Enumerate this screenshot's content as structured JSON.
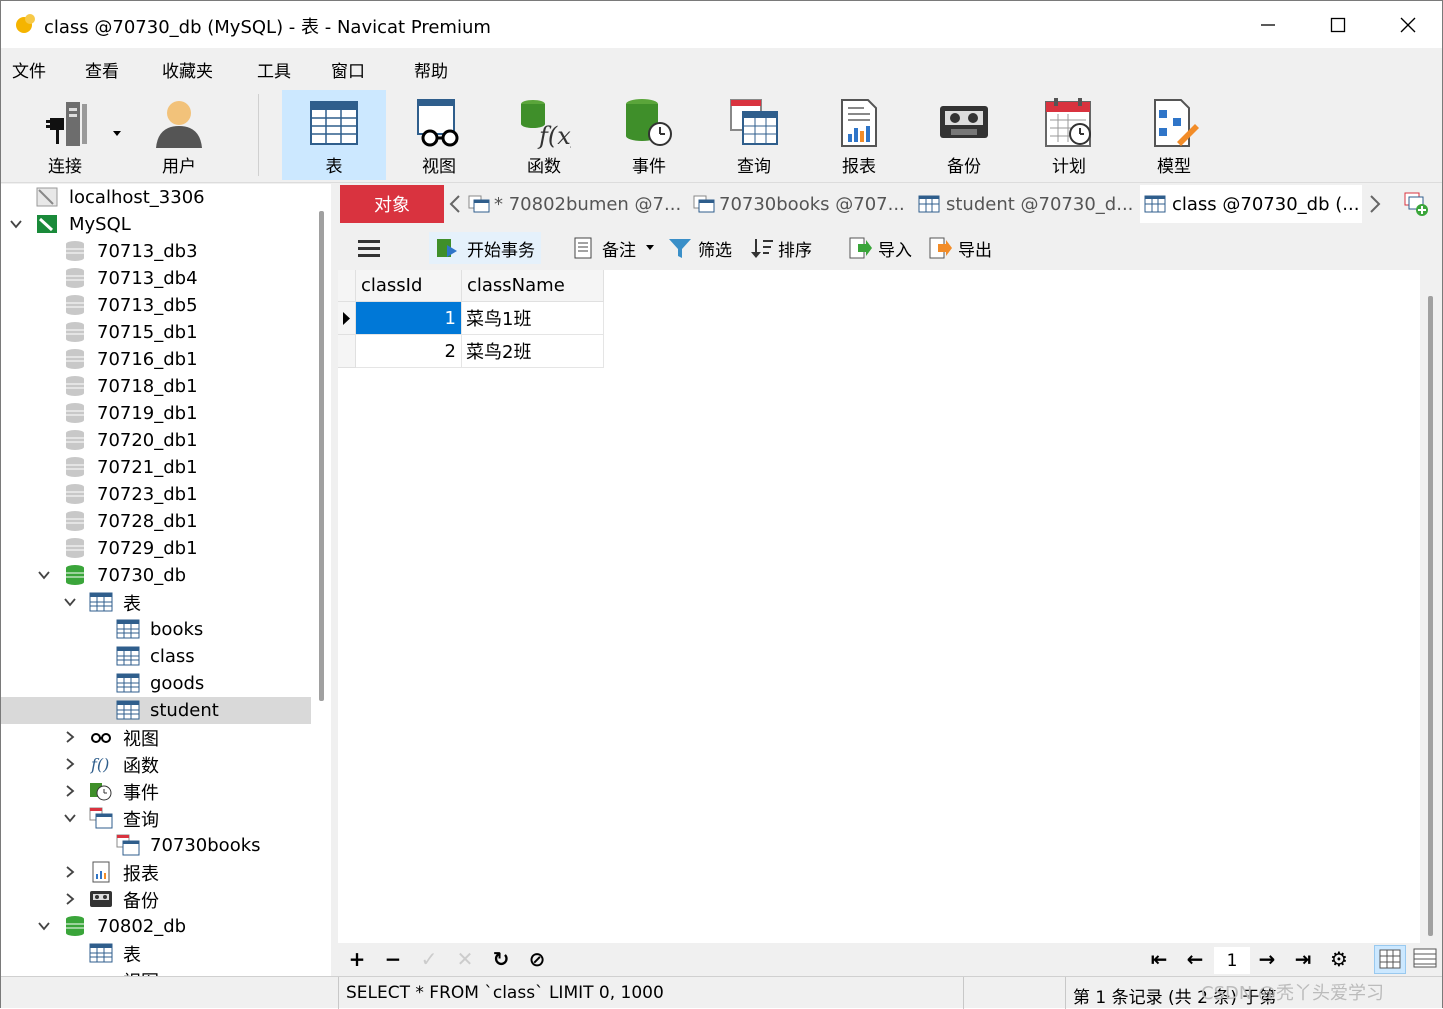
{
  "window": {
    "title": "class @70730_db (MySQL) - 表 - Navicat Premium"
  },
  "menu": [
    "文件",
    "查看",
    "收藏夹",
    "工具",
    "窗口",
    "帮助"
  ],
  "toolbar": {
    "connect": "连接",
    "user": "用户",
    "table": "表",
    "view": "视图",
    "function": "函数",
    "event": "事件",
    "query": "查询",
    "report": "报表",
    "backup": "备份",
    "schedule": "计划",
    "model": "模型"
  },
  "tree": {
    "connection": "localhost_3306",
    "mysql": "MySQL",
    "dbs": [
      "70713_db3",
      "70713_db4",
      "70713_db5",
      "70715_db1",
      "70716_db1",
      "70718_db1",
      "70719_db1",
      "70720_db1",
      "70721_db1",
      "70723_db1",
      "70728_db1",
      "70729_db1"
    ],
    "open_db": "70730_db",
    "tables_folder": "表",
    "tables": [
      "books",
      "class",
      "goods",
      "student"
    ],
    "views_folder": "视图",
    "functions_folder": "函数",
    "events_folder": "事件",
    "queries_folder": "查询",
    "query_item": "70730books",
    "reports_folder": "报表",
    "backups_folder": "备份",
    "db2": "70802_db",
    "db2_tables": "表",
    "cut_off": "视图"
  },
  "tabs": {
    "objects": "对象",
    "items": [
      "* 70802bumen @7...",
      "70730books @707...",
      "student @70730_d...",
      "class @70730_db (..."
    ]
  },
  "subtoolbar": {
    "begin_tx": "开始事务",
    "memo": "备注",
    "filter": "筛选",
    "sort": "排序",
    "import": "导入",
    "export": "导出"
  },
  "grid": {
    "columns": [
      "classId",
      "className"
    ],
    "rows": [
      [
        "1",
        "菜鸟1班"
      ],
      [
        "2",
        "菜鸟2班"
      ]
    ]
  },
  "nav": {
    "page": "1"
  },
  "status": {
    "sql": "SELECT * FROM `class` LIMIT 0, 1000",
    "records": "第 1 条记录 (共 2 条) 于第",
    "watermark": "CSDN @秃丫头爱学习"
  },
  "colors": {
    "accent_tab": "#d9333f",
    "selected_row": "#0078d7",
    "active_tool": "#cce8ff"
  }
}
